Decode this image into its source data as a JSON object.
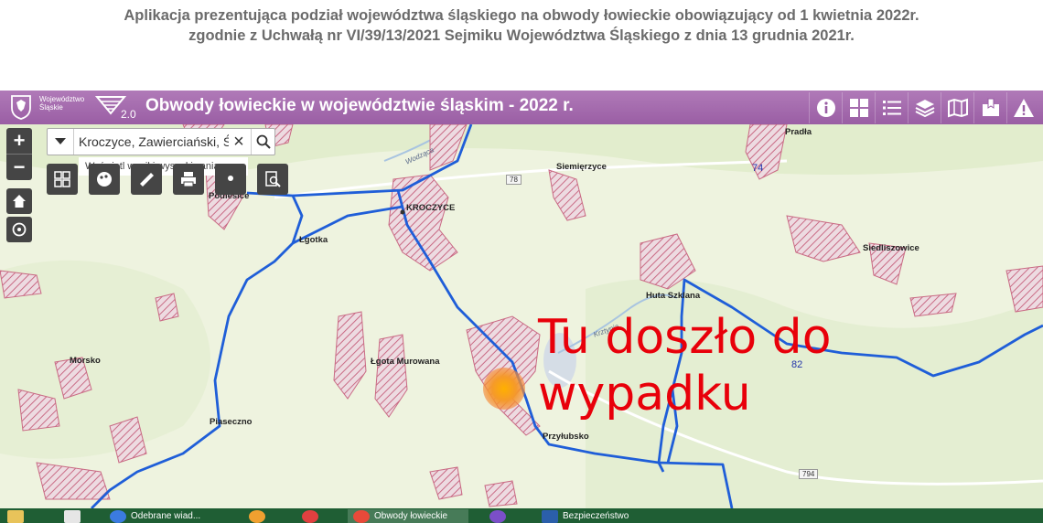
{
  "caption": {
    "line1": "Aplikacja prezentująca podział województwa śląskiego na obwody łowieckie obowiązujący od 1 kwietnia 2022r.",
    "line2": "zgodnie z Uchwałą nr VI/39/13/2021 Sejmiku Województwa Śląskiego z dnia 13 grudnia 2021r."
  },
  "header": {
    "org_line1": "Województwo",
    "org_line2": "Śląskie",
    "logo_version": "2.0",
    "title": "Obwody łowieckie w województwie śląskim - 2022 r.",
    "tools": [
      "info-icon",
      "grid-icon",
      "list-icon",
      "layers-icon",
      "map-icon",
      "bookmark-icon",
      "warning-icon"
    ]
  },
  "search": {
    "value": "Kroczyce, Zawierciański, Śl",
    "suggestion": "Wyświetl wyniki wyszukiwania ..."
  },
  "zoom": {
    "in": "+",
    "out": "−"
  },
  "map": {
    "places": [
      "Pradła",
      "Siemięrzyce",
      "Podlesice",
      "KROCZYCE",
      "Łgotka",
      "Siedliszowice",
      "Huta Szklana",
      "Morsko",
      "Łgota Murowana",
      "Piaseczno",
      "Przyłubsko"
    ],
    "rivers": [
      "Wodząca",
      "Krztynia"
    ],
    "roads": [
      "78",
      "794"
    ],
    "blue_numbers": [
      "74",
      "82"
    ],
    "accent_color": "#e8000a",
    "boundary_color": "#1f5ed8",
    "hatch_color": "#c96a84"
  },
  "annotation": {
    "line1": "Tu doszło do",
    "line2": "wypadku"
  },
  "taskbar": {
    "items": [
      "Odebrane wiad...",
      "Obwody łowieckie",
      "Bezpieczeństwo"
    ]
  }
}
